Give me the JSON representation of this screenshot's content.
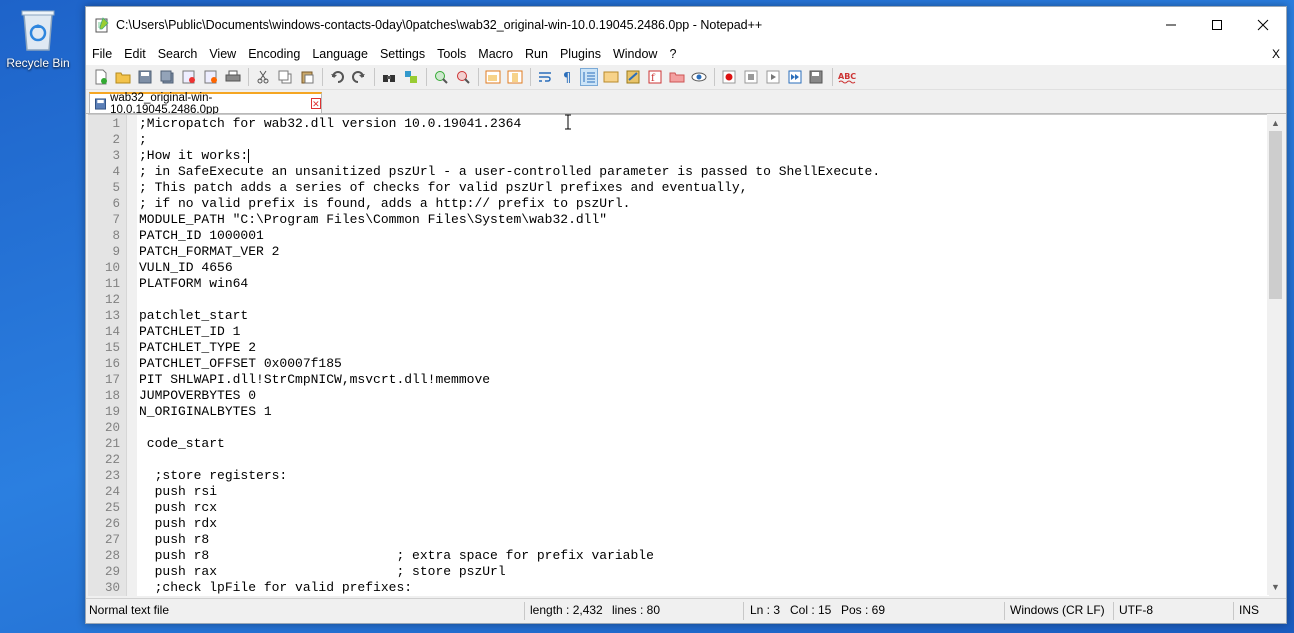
{
  "desktop": {
    "recycle_bin_label": "Recycle Bin"
  },
  "window": {
    "title": "C:\\Users\\Public\\Documents\\windows-contacts-0day\\0patches\\wab32_original-win-10.0.19045.2486.0pp - Notepad++"
  },
  "menu": {
    "items": [
      "File",
      "Edit",
      "Search",
      "View",
      "Encoding",
      "Language",
      "Settings",
      "Tools",
      "Macro",
      "Run",
      "Plugins",
      "Window",
      "?"
    ],
    "close_doc": "X"
  },
  "tab": {
    "label": "wab32_original-win-10.0.19045.2486.0pp"
  },
  "editor": {
    "lines": [
      ";Micropatch for wab32.dll version 10.0.19041.2364",
      ";",
      ";How it works:",
      "; in SafeExecute an unsanitized pszUrl - a user-controlled parameter is passed to ShellExecute.",
      "; This patch adds a series of checks for valid pszUrl prefixes and eventually,",
      "; if no valid prefix is found, adds a http:// prefix to pszUrl.",
      "MODULE_PATH \"C:\\Program Files\\Common Files\\System\\wab32.dll\"",
      "PATCH_ID 1000001",
      "PATCH_FORMAT_VER 2",
      "VULN_ID 4656",
      "PLATFORM win64",
      "",
      "patchlet_start",
      "PATCHLET_ID 1",
      "PATCHLET_TYPE 2",
      "PATCHLET_OFFSET 0x0007f185",
      "PIT SHLWAPI.dll!StrCmpNICW,msvcrt.dll!memmove",
      "JUMPOVERBYTES 0",
      "N_ORIGINALBYTES 1",
      "",
      " code_start",
      "",
      "  ;store registers:",
      "  push rsi",
      "  push rcx",
      "  push rdx",
      "  push r8",
      "  push r8                        ; extra space for prefix variable",
      "  push rax                       ; store pszUrl",
      "  ;check lpFile for valid prefixes:"
    ],
    "line_numbers": [
      "1",
      "2",
      "3",
      "4",
      "5",
      "6",
      "7",
      "8",
      "9",
      "10",
      "11",
      "12",
      "13",
      "14",
      "15",
      "16",
      "17",
      "18",
      "19",
      "20",
      "21",
      "22",
      "23",
      "24",
      "25",
      "26",
      "27",
      "28",
      "29",
      "30"
    ]
  },
  "status": {
    "file_type": "Normal text file",
    "length": "length : 2,432",
    "lines": "lines : 80",
    "ln": "Ln : 3",
    "col": "Col : 15",
    "pos": "Pos : 69",
    "eol": "Windows (CR LF)",
    "encoding": "UTF-8",
    "mode": "INS"
  },
  "colors": {
    "tab_accent": "#f5a623",
    "desktop": "#1f6fd6"
  }
}
